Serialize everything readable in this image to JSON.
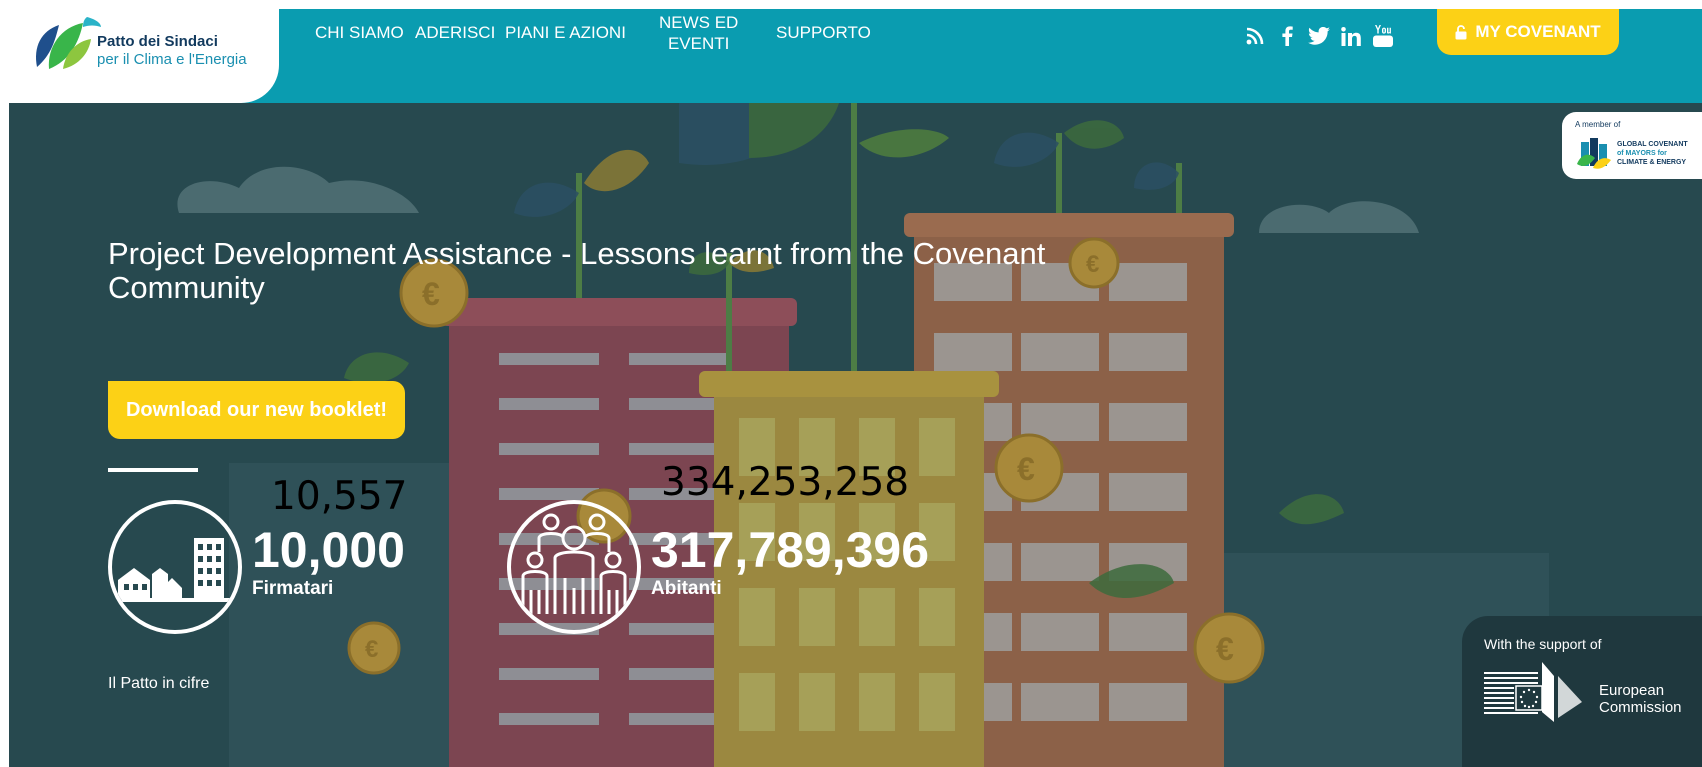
{
  "header": {
    "logo": {
      "title": "Patto dei Sindaci",
      "subtitle": "per il Clima e l'Energia"
    },
    "nav": [
      {
        "label": "CHI SIAMO"
      },
      {
        "label": "ADERISCI"
      },
      {
        "label": "PIANI E AZIONI"
      },
      {
        "label_line1": "NEWS ED",
        "label_line2": "EVENTI"
      },
      {
        "label": "SUPPORTO"
      }
    ],
    "social_icons": [
      "rss-icon",
      "facebook-icon",
      "twitter-icon",
      "linkedin-icon",
      "youtube-icon"
    ],
    "my_covenant_label": "MY COVENANT",
    "colors": {
      "bar": "#0a9cb0",
      "accent": "#fcd116"
    }
  },
  "hero": {
    "gcom": {
      "member_text": "A member of",
      "line1": "GLOBAL COVENANT",
      "line2": "of MAYORS for",
      "line3": "CLIMATE & ENERGY"
    },
    "title": "Project Development Assistance - Lessons learnt from the Covenant Community",
    "booklet_button_label": "Download our new booklet!",
    "stats": [
      {
        "overlay_value": "10,557",
        "value": "10,000",
        "label": "Firmatari",
        "icon": "town-icon"
      },
      {
        "overlay_value": "334,253,258",
        "value": "317,789,396",
        "label": "Abitanti",
        "icon": "people-icon"
      }
    ],
    "cifre_link": "Il Patto in cifre",
    "support": {
      "text": "With the support of",
      "org_line1": "European",
      "org_line2": "Commission"
    }
  }
}
